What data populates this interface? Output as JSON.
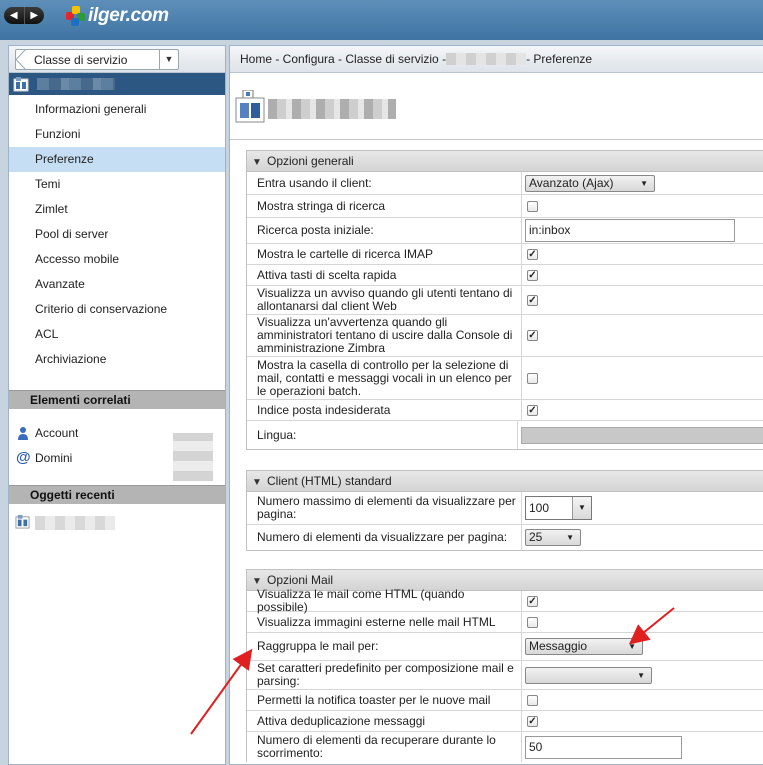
{
  "header": {
    "logo_text": "ilger.com",
    "back_icon": "chevron-left-icon",
    "forward_icon": "chevron-right-icon"
  },
  "left_panel": {
    "cos_selector": {
      "label": "Classe di servizio"
    },
    "nav_items": [
      {
        "label": "Informazioni generali"
      },
      {
        "label": "Funzioni"
      },
      {
        "label": "Preferenze",
        "selected": true
      },
      {
        "label": "Temi"
      },
      {
        "label": "Zimlet"
      },
      {
        "label": "Pool di server"
      },
      {
        "label": "Accesso mobile"
      },
      {
        "label": "Avanzate"
      },
      {
        "label": "Criterio di conservazione"
      },
      {
        "label": "ACL"
      },
      {
        "label": "Archiviazione"
      }
    ],
    "related": {
      "title": "Elementi correlati",
      "items": [
        {
          "label": "Account",
          "icon": "user-icon"
        },
        {
          "label": "Domini",
          "icon": "at-icon"
        }
      ]
    },
    "recent": {
      "title": "Oggetti recenti"
    }
  },
  "breadcrumb": {
    "prefix": "Home - Configura - Classe di servizio -",
    "suffix": "- Preferenze"
  },
  "sections": {
    "general": {
      "title": "Opzioni generali",
      "rows": [
        {
          "label": "Entra usando il client:",
          "select": "Avanzato (Ajax)"
        },
        {
          "label": "Mostra stringa di ricerca",
          "checked": false
        },
        {
          "label": "Ricerca posta iniziale:",
          "input": "in:inbox"
        },
        {
          "label": "Mostra le cartelle di ricerca IMAP",
          "checked": true
        },
        {
          "label": "Attiva tasti di scelta rapida",
          "checked": true
        },
        {
          "label": "Visualizza un avviso quando gli utenti tentano di allontanarsi dal client Web",
          "checked": true
        },
        {
          "label": "Visualizza un'avvertenza quando gli amministratori tentano di uscire dalla Console di amministrazione Zimbra",
          "checked": true
        },
        {
          "label": "Mostra la casella di controllo per la selezione di mail, contatti e messaggi vocali in un elenco per le operazioni batch.",
          "checked": false
        },
        {
          "label": "Indice posta indesiderata",
          "checked": true
        },
        {
          "label": "Lingua:",
          "select": ""
        }
      ]
    },
    "html_client": {
      "title": "Client (HTML) standard",
      "rows": [
        {
          "label": "Numero massimo di elementi da visualizzare per pagina:",
          "combo": "100"
        },
        {
          "label": "Numero di elementi da visualizzare per pagina:",
          "select": "25"
        }
      ]
    },
    "mail": {
      "title": "Opzioni Mail",
      "rows": [
        {
          "label": "Visualizza le mail come HTML (quando possibile)",
          "checked": true
        },
        {
          "label": "Visualizza immagini esterne nelle mail HTML",
          "checked": false
        },
        {
          "label": "Raggruppa le mail per:",
          "select": "Messaggio"
        },
        {
          "label": "Set caratteri predefinito per composizione mail e parsing:",
          "select": ""
        },
        {
          "label": "Permetti la notifica toaster per le nuove mail",
          "checked": false
        },
        {
          "label": "Attiva deduplicazione messaggi",
          "checked": true
        },
        {
          "label": "Numero di elementi da recuperare durante lo scorrimento:",
          "input": "50"
        }
      ]
    }
  },
  "colors": {
    "accent": "#2c5782",
    "selected_row": "#c6def3",
    "annotation_arrow": "#e02020"
  }
}
